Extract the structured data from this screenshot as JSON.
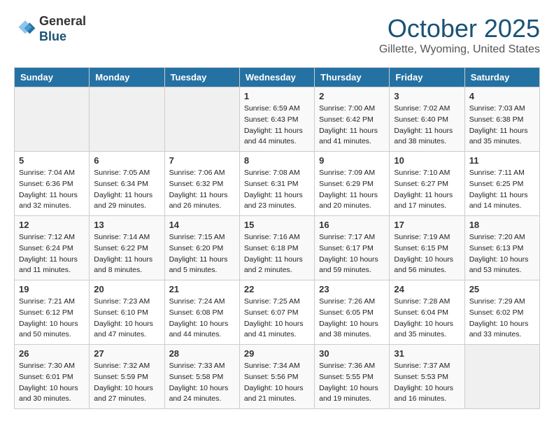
{
  "header": {
    "logo_line1": "General",
    "logo_line2": "Blue",
    "month": "October 2025",
    "location": "Gillette, Wyoming, United States"
  },
  "weekdays": [
    "Sunday",
    "Monday",
    "Tuesday",
    "Wednesday",
    "Thursday",
    "Friday",
    "Saturday"
  ],
  "weeks": [
    [
      {
        "day": "",
        "info": ""
      },
      {
        "day": "",
        "info": ""
      },
      {
        "day": "",
        "info": ""
      },
      {
        "day": "1",
        "info": "Sunrise: 6:59 AM\nSunset: 6:43 PM\nDaylight: 11 hours\nand 44 minutes."
      },
      {
        "day": "2",
        "info": "Sunrise: 7:00 AM\nSunset: 6:42 PM\nDaylight: 11 hours\nand 41 minutes."
      },
      {
        "day": "3",
        "info": "Sunrise: 7:02 AM\nSunset: 6:40 PM\nDaylight: 11 hours\nand 38 minutes."
      },
      {
        "day": "4",
        "info": "Sunrise: 7:03 AM\nSunset: 6:38 PM\nDaylight: 11 hours\nand 35 minutes."
      }
    ],
    [
      {
        "day": "5",
        "info": "Sunrise: 7:04 AM\nSunset: 6:36 PM\nDaylight: 11 hours\nand 32 minutes."
      },
      {
        "day": "6",
        "info": "Sunrise: 7:05 AM\nSunset: 6:34 PM\nDaylight: 11 hours\nand 29 minutes."
      },
      {
        "day": "7",
        "info": "Sunrise: 7:06 AM\nSunset: 6:32 PM\nDaylight: 11 hours\nand 26 minutes."
      },
      {
        "day": "8",
        "info": "Sunrise: 7:08 AM\nSunset: 6:31 PM\nDaylight: 11 hours\nand 23 minutes."
      },
      {
        "day": "9",
        "info": "Sunrise: 7:09 AM\nSunset: 6:29 PM\nDaylight: 11 hours\nand 20 minutes."
      },
      {
        "day": "10",
        "info": "Sunrise: 7:10 AM\nSunset: 6:27 PM\nDaylight: 11 hours\nand 17 minutes."
      },
      {
        "day": "11",
        "info": "Sunrise: 7:11 AM\nSunset: 6:25 PM\nDaylight: 11 hours\nand 14 minutes."
      }
    ],
    [
      {
        "day": "12",
        "info": "Sunrise: 7:12 AM\nSunset: 6:24 PM\nDaylight: 11 hours\nand 11 minutes."
      },
      {
        "day": "13",
        "info": "Sunrise: 7:14 AM\nSunset: 6:22 PM\nDaylight: 11 hours\nand 8 minutes."
      },
      {
        "day": "14",
        "info": "Sunrise: 7:15 AM\nSunset: 6:20 PM\nDaylight: 11 hours\nand 5 minutes."
      },
      {
        "day": "15",
        "info": "Sunrise: 7:16 AM\nSunset: 6:18 PM\nDaylight: 11 hours\nand 2 minutes."
      },
      {
        "day": "16",
        "info": "Sunrise: 7:17 AM\nSunset: 6:17 PM\nDaylight: 10 hours\nand 59 minutes."
      },
      {
        "day": "17",
        "info": "Sunrise: 7:19 AM\nSunset: 6:15 PM\nDaylight: 10 hours\nand 56 minutes."
      },
      {
        "day": "18",
        "info": "Sunrise: 7:20 AM\nSunset: 6:13 PM\nDaylight: 10 hours\nand 53 minutes."
      }
    ],
    [
      {
        "day": "19",
        "info": "Sunrise: 7:21 AM\nSunset: 6:12 PM\nDaylight: 10 hours\nand 50 minutes."
      },
      {
        "day": "20",
        "info": "Sunrise: 7:23 AM\nSunset: 6:10 PM\nDaylight: 10 hours\nand 47 minutes."
      },
      {
        "day": "21",
        "info": "Sunrise: 7:24 AM\nSunset: 6:08 PM\nDaylight: 10 hours\nand 44 minutes."
      },
      {
        "day": "22",
        "info": "Sunrise: 7:25 AM\nSunset: 6:07 PM\nDaylight: 10 hours\nand 41 minutes."
      },
      {
        "day": "23",
        "info": "Sunrise: 7:26 AM\nSunset: 6:05 PM\nDaylight: 10 hours\nand 38 minutes."
      },
      {
        "day": "24",
        "info": "Sunrise: 7:28 AM\nSunset: 6:04 PM\nDaylight: 10 hours\nand 35 minutes."
      },
      {
        "day": "25",
        "info": "Sunrise: 7:29 AM\nSunset: 6:02 PM\nDaylight: 10 hours\nand 33 minutes."
      }
    ],
    [
      {
        "day": "26",
        "info": "Sunrise: 7:30 AM\nSunset: 6:01 PM\nDaylight: 10 hours\nand 30 minutes."
      },
      {
        "day": "27",
        "info": "Sunrise: 7:32 AM\nSunset: 5:59 PM\nDaylight: 10 hours\nand 27 minutes."
      },
      {
        "day": "28",
        "info": "Sunrise: 7:33 AM\nSunset: 5:58 PM\nDaylight: 10 hours\nand 24 minutes."
      },
      {
        "day": "29",
        "info": "Sunrise: 7:34 AM\nSunset: 5:56 PM\nDaylight: 10 hours\nand 21 minutes."
      },
      {
        "day": "30",
        "info": "Sunrise: 7:36 AM\nSunset: 5:55 PM\nDaylight: 10 hours\nand 19 minutes."
      },
      {
        "day": "31",
        "info": "Sunrise: 7:37 AM\nSunset: 5:53 PM\nDaylight: 10 hours\nand 16 minutes."
      },
      {
        "day": "",
        "info": ""
      }
    ]
  ]
}
